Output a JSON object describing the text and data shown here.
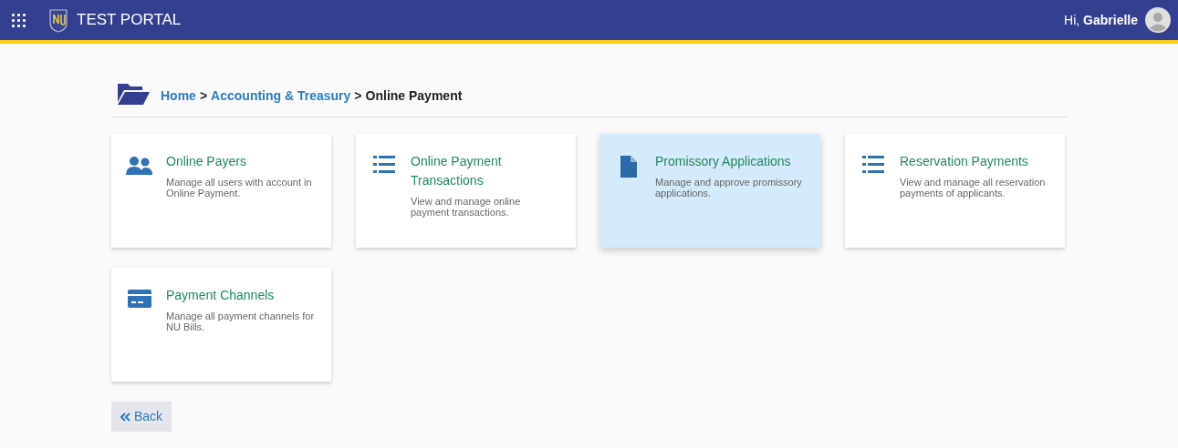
{
  "header": {
    "title": "TEST PORTAL",
    "greeting": "Hi, **Gabrielle**"
  },
  "breadcrumb": {
    "separator": ">",
    "items": [
      {
        "label": "Home",
        "current": false
      },
      {
        "label": "Accounting & Treasury",
        "current": false
      },
      {
        "label": "Online Payment",
        "current": true
      }
    ]
  },
  "tiles": [
    {
      "kind": "people",
      "title": "Online Payers",
      "description": "Manage all users with account in Online Payment.",
      "selected": false
    },
    {
      "kind": "list",
      "title": "Online Payment Transactions",
      "description": "View and manage online payment transactions.",
      "selected": false
    },
    {
      "kind": "document",
      "title": "Promissory Applications",
      "description": "Manage and approve promissory applications.",
      "selected": true
    },
    {
      "kind": "list",
      "title": "Reservation Payments",
      "description": "View and manage all reservation payments of applicants.",
      "selected": false
    },
    {
      "kind": "card",
      "title": "Payment Channels",
      "description": "Manage all payment channels for NU Bills.",
      "selected": false
    }
  ],
  "back_button": {
    "label": "Back"
  }
}
